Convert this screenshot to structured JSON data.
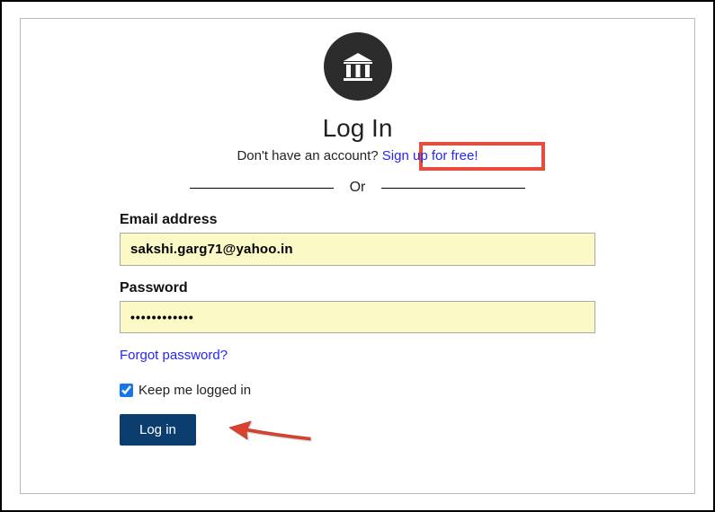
{
  "header": {
    "title": "Log In",
    "prompt_text": "Don't have an account? ",
    "signup_link_text": "Sign up for free!",
    "divider_text": "Or"
  },
  "form": {
    "email_label": "Email address",
    "email_value": "sakshi.garg71@yahoo.in",
    "password_label": "Password",
    "password_value": "••••••••••••",
    "forgot_link_text": "Forgot password?",
    "keep_logged_label": "Keep me logged in",
    "keep_logged_checked": true,
    "login_button_text": "Log in"
  },
  "annotations": {
    "signup_highlight": true,
    "arrow_to_login": true
  }
}
